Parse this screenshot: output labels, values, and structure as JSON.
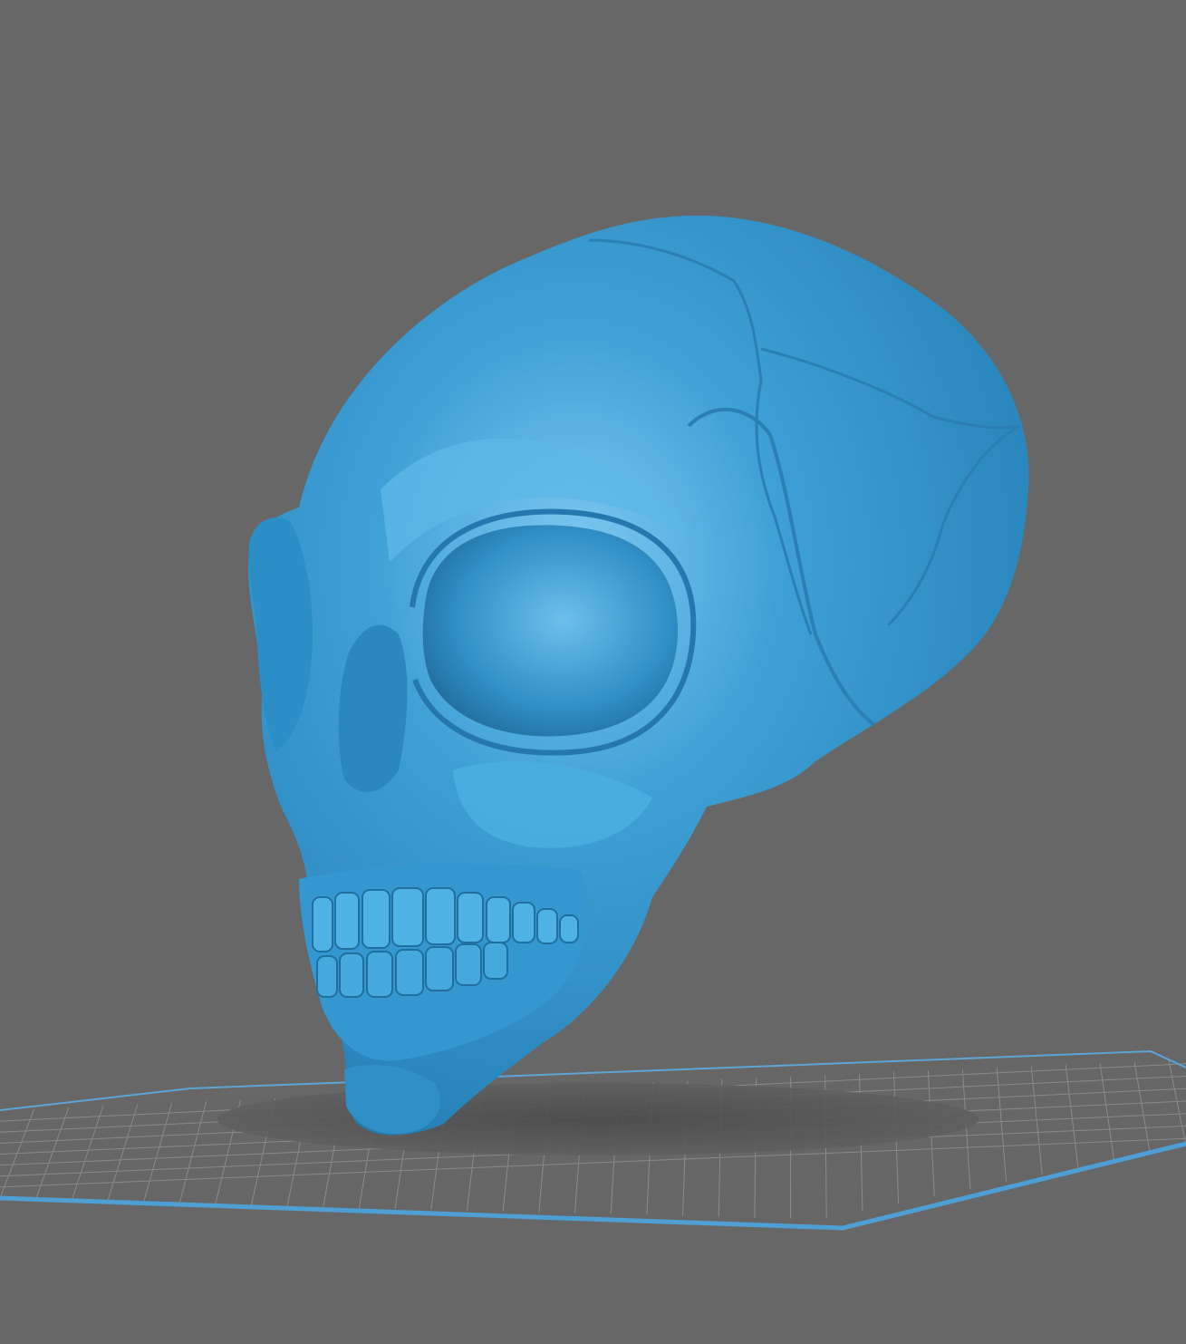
{
  "viewport": {
    "background_color": "#676767"
  },
  "build_plate": {
    "grid_line_color": "#8a8a8a",
    "border_color": "#4e9fd4",
    "plate_color": "#666666"
  },
  "model": {
    "name": "skull-model",
    "color": "#3ea0d6",
    "shadow_color": "#4e4e4e"
  }
}
